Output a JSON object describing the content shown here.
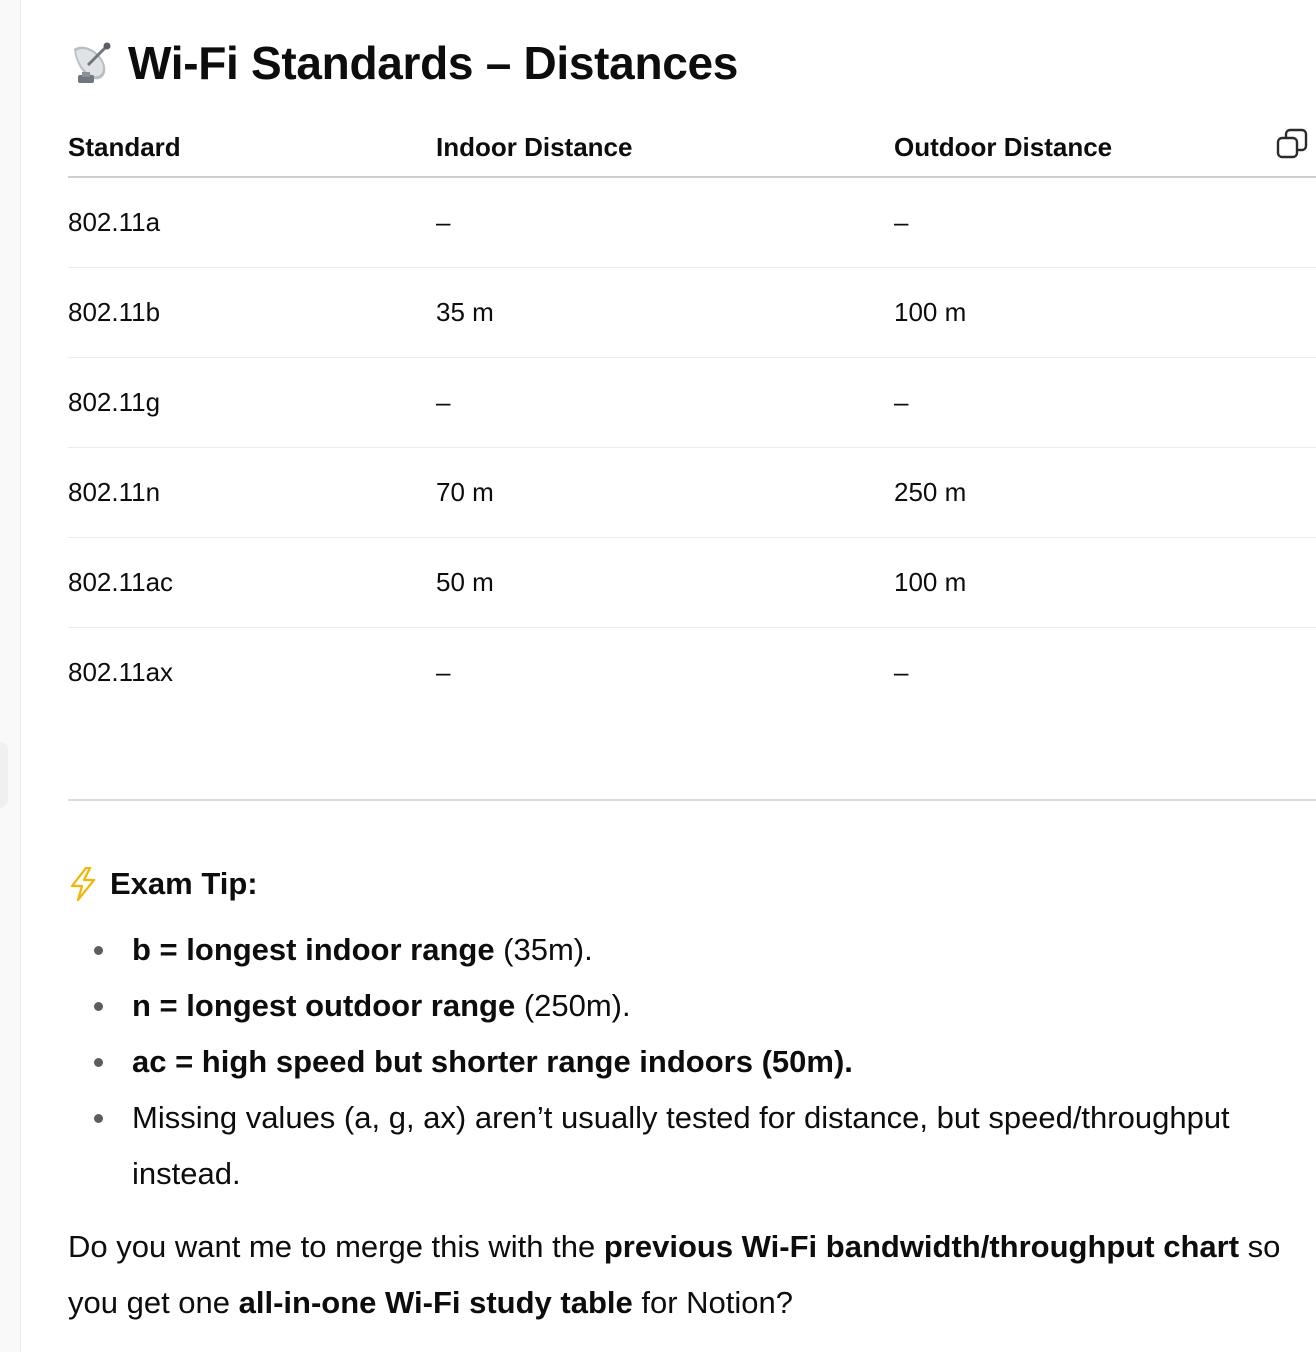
{
  "title": "Wi-Fi Standards – Distances",
  "table": {
    "headers": [
      "Standard",
      "Indoor Distance",
      "Outdoor Distance"
    ],
    "rows": [
      [
        "802.11a",
        "–",
        "–"
      ],
      [
        "802.11b",
        "35 m",
        "100 m"
      ],
      [
        "802.11g",
        "–",
        "–"
      ],
      [
        "802.11n",
        "70 m",
        "250 m"
      ],
      [
        "802.11ac",
        "50 m",
        "100 m"
      ],
      [
        "802.11ax",
        "–",
        "–"
      ]
    ]
  },
  "tip": {
    "heading": "Exam Tip:",
    "items": [
      {
        "bold": "b = longest indoor range",
        "rest": " (35m)."
      },
      {
        "bold": "n = longest outdoor range",
        "rest": " (250m)."
      },
      {
        "bold": "ac = high speed but shorter range indoors (50m).",
        "rest": ""
      },
      {
        "bold": "",
        "rest": "Missing values (a, g, ax) aren’t usually tested for distance, but speed/throughput instead."
      }
    ]
  },
  "followup": {
    "part1": "Do you want me to merge this with the ",
    "bold1": "previous Wi-Fi bandwidth/throughput chart",
    "part2": " so you get one ",
    "bold2": "all-in-one Wi-Fi study table",
    "part3": " for Notion?"
  },
  "icons": {
    "title": "satellite-antenna-icon",
    "tip": "lightning-icon",
    "copy": "copy-icon"
  },
  "colors": {
    "text": "#0d0d0d",
    "bolt": "#f4b400"
  }
}
